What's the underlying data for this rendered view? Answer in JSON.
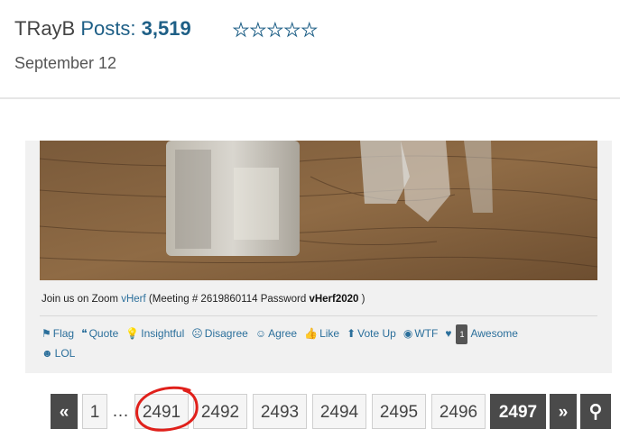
{
  "author": {
    "name": "TRayB",
    "posts_label": "Posts:",
    "posts_count": "3,519",
    "stars": "★★★★★"
  },
  "post": {
    "date": "September 12",
    "zoom": {
      "prefix": "Join us on Zoom",
      "link": "vHerf",
      "meeting": "(Meeting # 2619860114 Password",
      "password": "vHerf2020",
      "suffix": ")"
    }
  },
  "reactions": [
    {
      "icon": "flag-icon",
      "glyph": "⚑",
      "label": "Flag"
    },
    {
      "icon": "quote-icon",
      "glyph": "❝",
      "label": "Quote"
    },
    {
      "icon": "lightbulb-icon",
      "glyph": "💡",
      "label": "Insightful"
    },
    {
      "icon": "frown-icon",
      "glyph": "☹",
      "label": "Disagree"
    },
    {
      "icon": "smile-icon",
      "glyph": "☺",
      "label": "Agree"
    },
    {
      "icon": "thumbs-up-icon",
      "glyph": "👍",
      "label": "Like"
    },
    {
      "icon": "arrow-up-icon",
      "glyph": "⬆",
      "label": "Vote Up"
    },
    {
      "icon": "wtf-icon",
      "glyph": "◉",
      "label": "WTF"
    },
    {
      "icon": "heart-icon",
      "glyph": "♥",
      "label": "Awesome",
      "count": "1"
    },
    {
      "icon": "laugh-icon",
      "glyph": "☻",
      "label": "LOL"
    }
  ],
  "pagination": {
    "prev": "«",
    "first": "1",
    "ellipsis": "…",
    "pages": [
      "2491",
      "2492",
      "2493",
      "2494",
      "2495",
      "2496"
    ],
    "current": "2497",
    "next": "»",
    "search_glyph": "⚲"
  }
}
